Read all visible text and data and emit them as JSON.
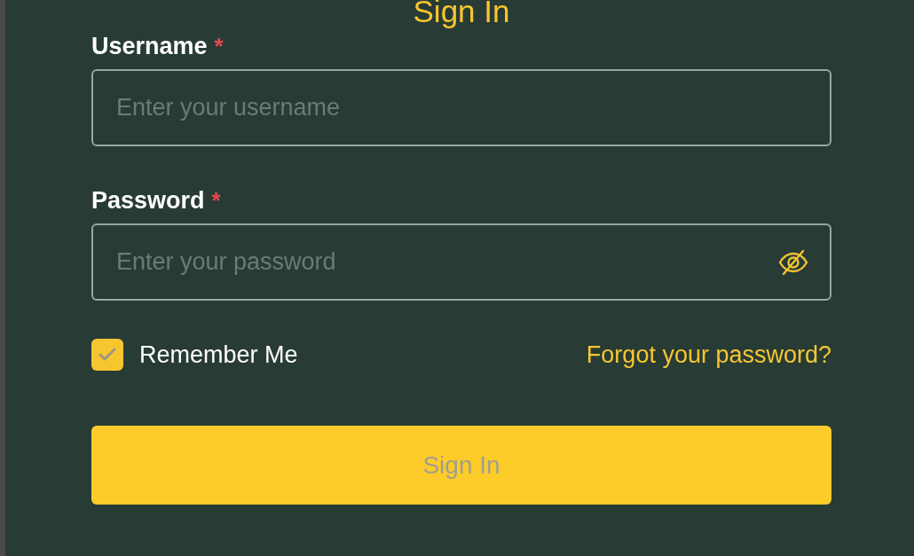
{
  "title": "Sign In",
  "fields": [
    {
      "label": "Username",
      "required": true,
      "required_mark": "*",
      "placeholder": "Enter your username",
      "kind": "text"
    },
    {
      "label": "Password",
      "required": true,
      "required_mark": "*",
      "placeholder": "Enter your password",
      "kind": "password"
    }
  ],
  "remember": {
    "label": "Remember Me",
    "checked": true
  },
  "forgot_link": "Forgot your password?",
  "submit": {
    "label": "Sign In",
    "disabled": true
  }
}
